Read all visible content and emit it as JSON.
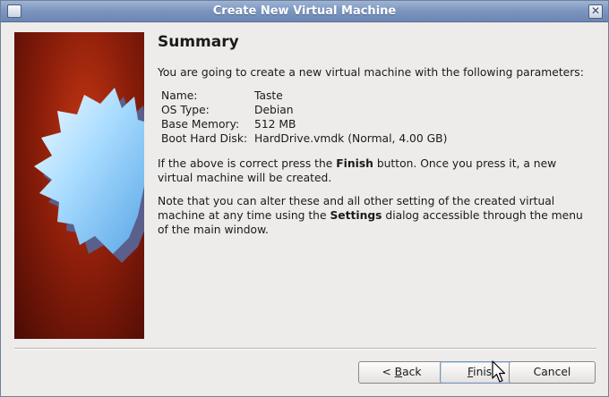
{
  "window": {
    "title": "Create New Virtual Machine",
    "close_glyph": "✕"
  },
  "summary": {
    "heading": "Summary",
    "intro": "You are going to create a new virtual machine with the following parameters:",
    "params": [
      {
        "key": "Name:",
        "value": "Taste"
      },
      {
        "key": "OS Type:",
        "value": "Debian"
      },
      {
        "key": "Base Memory:",
        "value": "512 MB"
      },
      {
        "key": "Boot Hard Disk:",
        "value": "HardDrive.vmdk (Normal, 4.00 GB)"
      }
    ],
    "confirm_pre": "If the above is correct press the ",
    "confirm_bold": "Finish",
    "confirm_post": " button. Once you press it, a new virtual machine will be created.",
    "note_pre": "Note that you can alter these and all other setting of the created virtual machine at any time using the ",
    "note_bold": "Settings",
    "note_post": " dialog accessible through the menu of the main window."
  },
  "buttons": {
    "back_prefix": "< ",
    "back_mnemonic": "B",
    "back_rest": "ack",
    "finish_mnemonic": "F",
    "finish_rest": "inish",
    "cancel": "Cancel"
  },
  "icons": {
    "app": "virtualbox-app-icon",
    "close": "close-icon",
    "cursor": "mouse-pointer-icon"
  },
  "colors": {
    "titlebar": "#7d97c0",
    "banner_red": "#8c1e0a",
    "star": "#8fc9f5"
  }
}
